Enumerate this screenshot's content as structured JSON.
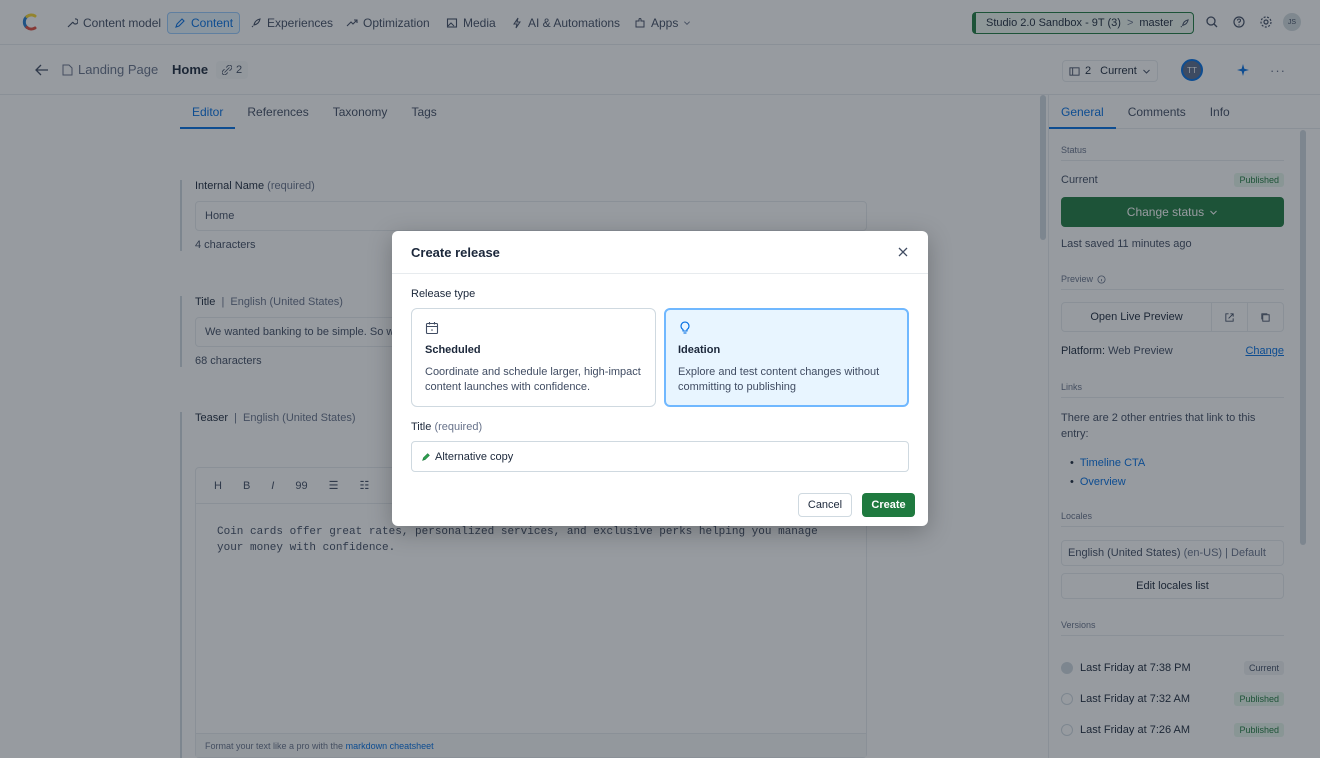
{
  "colors": {
    "accent": "#036fe3",
    "success": "#1f7a3f",
    "overlay": "#1c2430"
  },
  "topnav": {
    "items": [
      {
        "label": "Content model",
        "icon": "wrench-icon"
      },
      {
        "label": "Content",
        "icon": "pencil-icon"
      },
      {
        "label": "Experiences",
        "icon": "rocket-icon"
      },
      {
        "label": "Optimization",
        "icon": "trend-icon"
      },
      {
        "label": "Media",
        "icon": "image-icon"
      },
      {
        "label": "AI & Automations",
        "icon": "bolt-icon"
      },
      {
        "label": "Apps",
        "icon": "puzzle-icon"
      }
    ],
    "environment": {
      "space": "Studio 2.0 Sandbox - 9T (3)",
      "separator": ">",
      "branch": "master"
    },
    "avatar_initials": "JS"
  },
  "entry_header": {
    "content_type": "Landing Page",
    "title": "Home",
    "references_count": "2",
    "version_count": "2",
    "version_label": "Current",
    "avatar_initials": "TT",
    "more": "···"
  },
  "editor": {
    "tabs": [
      "Editor",
      "References",
      "Taxonomy",
      "Tags"
    ],
    "fields": {
      "internal_name": {
        "label": "Internal Name",
        "hint": "(required)",
        "value": "Home",
        "count": "4 characters"
      },
      "title": {
        "label": "Title",
        "separator": "|",
        "locale": "English (United States)",
        "value": "We wanted banking to be simple. So we made it so.",
        "count": "68 characters"
      },
      "teaser": {
        "label": "Teaser",
        "separator": "|",
        "locale": "English (United States)"
      }
    },
    "markdown": {
      "toolbar": [
        "H",
        "B",
        "I",
        "99",
        "☰",
        "☷"
      ],
      "body": "Coin cards offer great rates, personalized services, and exclusive perks helping you manage your money with confidence.",
      "footer_text": "Format your text like a pro with the",
      "footer_link": "markdown cheatsheet"
    }
  },
  "sidebar": {
    "tabs": [
      "General",
      "Comments",
      "Info"
    ],
    "status_heading": "Status",
    "status_value": "Current",
    "status_badge": "Published",
    "change_status": "Change status",
    "last_saved": "Last saved 11 minutes ago",
    "preview_heading": "Preview",
    "open_live_preview": "Open Live Preview",
    "platform_label": "Platform:",
    "platform_value": "Web Preview",
    "platform_change": "Change",
    "links_heading": "Links",
    "links_text": "There are 2 other entries that link to this entry:",
    "links": [
      "Timeline CTA",
      "Overview"
    ],
    "locales_heading": "Locales",
    "locale_value": "English (United States)",
    "locale_code": "(en-US)",
    "locale_default": "| Default",
    "edit_locales": "Edit locales list",
    "versions_heading": "Versions",
    "versions": [
      {
        "label": "Last Friday at 7:38 PM",
        "badge": "Current"
      },
      {
        "label": "Last Friday at 7:32 AM",
        "badge": "Published"
      },
      {
        "label": "Last Friday at 7:26 AM",
        "badge": "Published"
      }
    ]
  },
  "modal": {
    "title": "Create release",
    "release_type_label": "Release type",
    "options": [
      {
        "title": "Scheduled",
        "description": "Coordinate and schedule larger, high-impact content launches with confidence.",
        "icon": "calendar-icon",
        "selected": false
      },
      {
        "title": "Ideation",
        "description": "Explore and test content changes without committing to publishing",
        "icon": "lightbulb-icon",
        "selected": true
      }
    ],
    "title_field": {
      "label": "Title",
      "hint": "(required)",
      "value": "Alternative copy",
      "icon": "pencil-icon"
    },
    "cancel": "Cancel",
    "create": "Create"
  }
}
